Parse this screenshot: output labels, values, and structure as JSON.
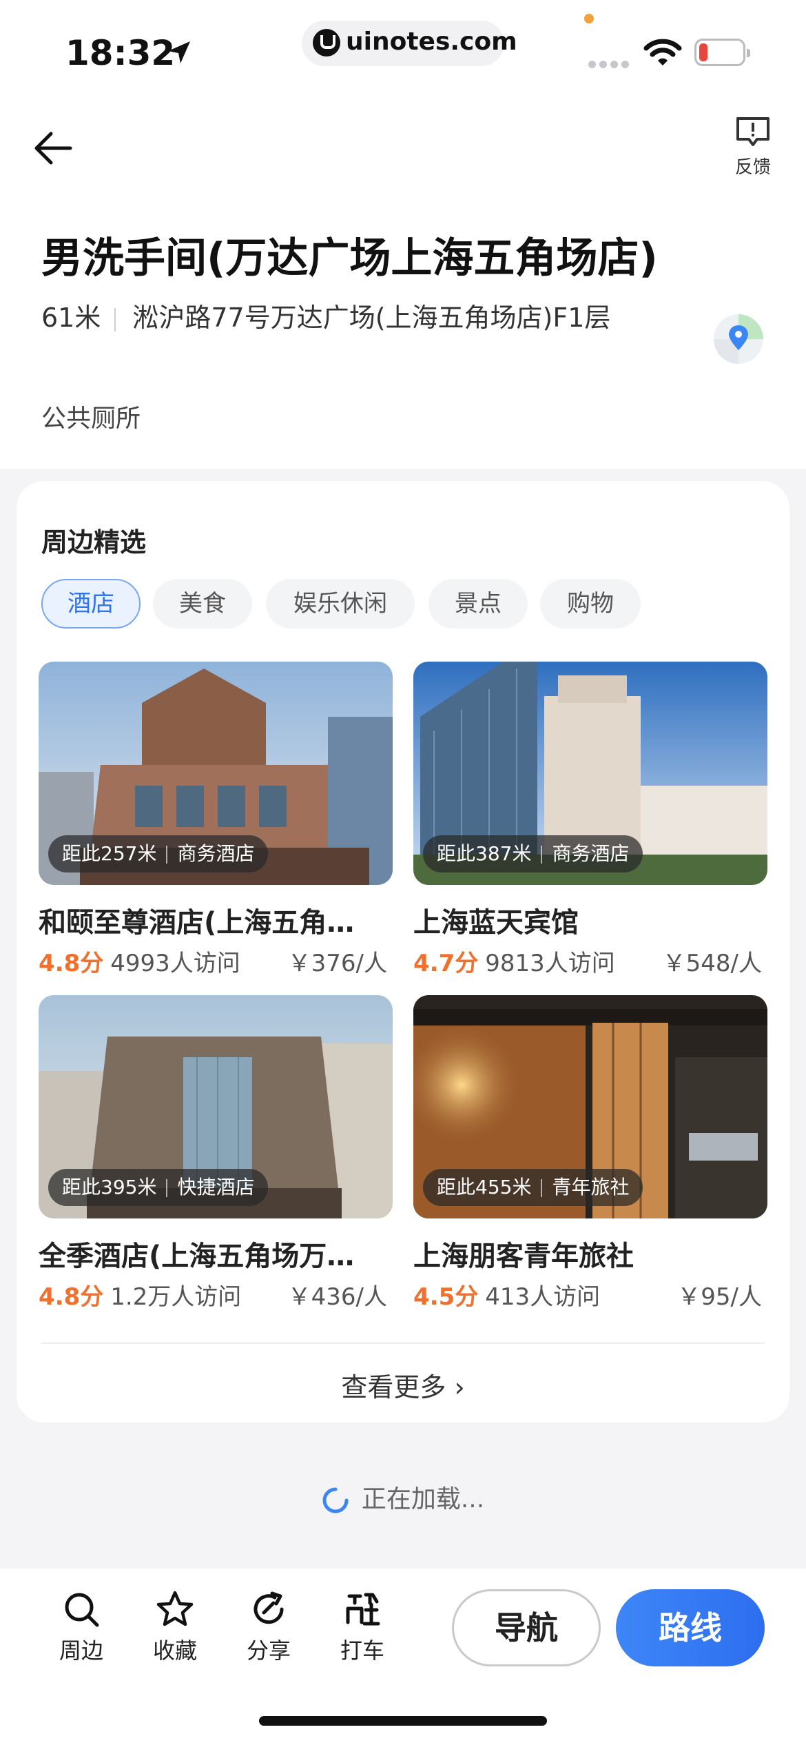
{
  "status_bar": {
    "time": "18:32",
    "url": "uinotes.com"
  },
  "header": {
    "feedback_label": "反馈"
  },
  "poi": {
    "title": "男洗手间(万达广场上海五角场店)",
    "distance": "61米",
    "address": "淞沪路77号万达广场(上海五角场店)F1层",
    "category": "公共厕所"
  },
  "nearby": {
    "title": "周边精选",
    "tabs": [
      {
        "label": "酒店",
        "active": true
      },
      {
        "label": "美食",
        "active": false
      },
      {
        "label": "娱乐休闲",
        "active": false
      },
      {
        "label": "景点",
        "active": false
      },
      {
        "label": "购物",
        "active": false
      }
    ],
    "hotels": [
      {
        "distance": "距此257米",
        "type": "商务酒店",
        "name": "和颐至尊酒店(上海五角…",
        "score": "4.8分",
        "visits": "4993人访问",
        "price": "￥376/人"
      },
      {
        "distance": "距此387米",
        "type": "商务酒店",
        "name": "上海蓝天宾馆",
        "score": "4.7分",
        "visits": "9813人访问",
        "price": "￥548/人"
      },
      {
        "distance": "距此395米",
        "type": "快捷酒店",
        "name": "全季酒店(上海五角场万…",
        "score": "4.8分",
        "visits": "1.2万人访问",
        "price": "￥436/人"
      },
      {
        "distance": "距此455米",
        "type": "青年旅社",
        "name": "上海朋客青年旅社",
        "score": "4.5分",
        "visits": "413人访问",
        "price": "￥95/人"
      }
    ],
    "more_label": "查看更多 ›"
  },
  "loading_text": "正在加载...",
  "bottom_bar": {
    "items": [
      {
        "label": "周边",
        "icon": "search-icon"
      },
      {
        "label": "收藏",
        "icon": "star-icon"
      },
      {
        "label": "分享",
        "icon": "share-icon"
      },
      {
        "label": "打车",
        "icon": "taxi-icon"
      }
    ],
    "nav_label": "导航",
    "route_label": "路线"
  },
  "colors": {
    "accent": "#2d74ee",
    "score": "#f0712d"
  }
}
